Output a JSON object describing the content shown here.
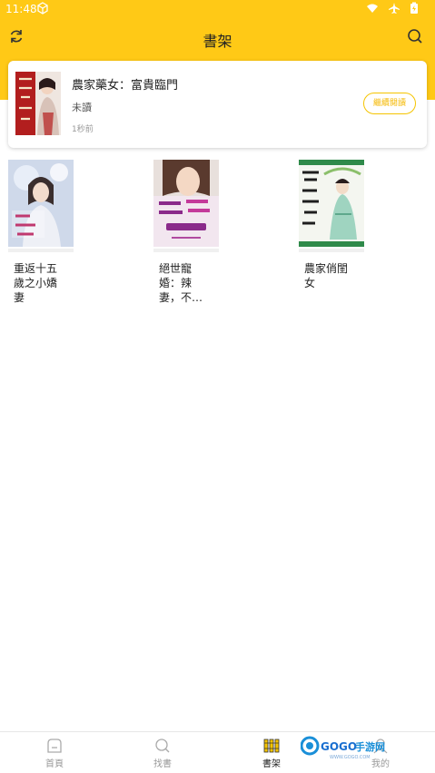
{
  "status": {
    "time": "11:48"
  },
  "header": {
    "title": "書架"
  },
  "recent": {
    "title": "農家藥女：富貴臨門",
    "status": "未讀",
    "time_ago": "1秒前",
    "continue_label": "繼續閱讀"
  },
  "shelf": [
    {
      "name": "重返十五歲之小嬌妻"
    },
    {
      "name": "絕世寵婚：辣妻，不…"
    },
    {
      "name": "農家俏閨女"
    }
  ],
  "nav": {
    "home": "首頁",
    "find": "找書",
    "shelf": "書架",
    "me": "我的"
  },
  "watermark": {
    "text": "GOGO手游网",
    "url": "WWW.GOGO.COM"
  },
  "colors": {
    "accent": "#ffc916"
  }
}
